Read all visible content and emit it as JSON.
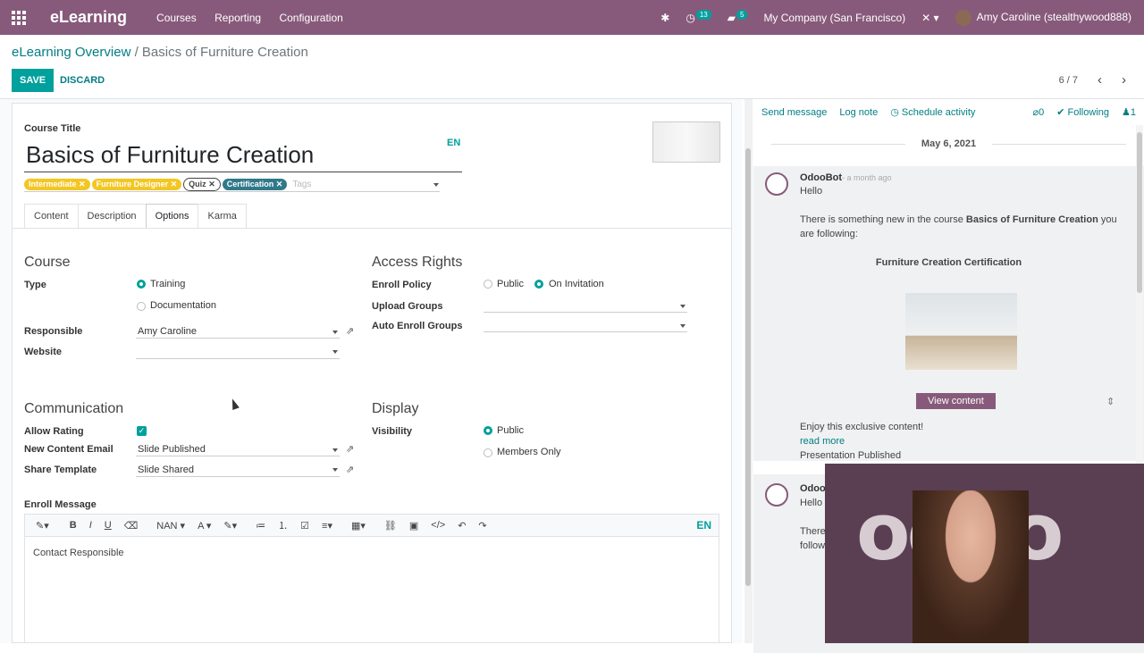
{
  "topbar": {
    "app_name": "eLearning",
    "menu": [
      "Courses",
      "Reporting",
      "Configuration"
    ],
    "activity_count": "13",
    "message_count": "5",
    "company": "My Company (San Francisco)",
    "user": "Amy Caroline (stealthywood888)"
  },
  "breadcrumb": {
    "parent": "eLearning Overview",
    "separator": "/",
    "current": "Basics of Furniture Creation"
  },
  "buttons": {
    "save": "SAVE",
    "discard": "DISCARD"
  },
  "pager": {
    "text": "6 / 7",
    "prev": "‹",
    "next": "›"
  },
  "form": {
    "course_title_label": "Course Title",
    "course_title": "Basics of Furniture Creation",
    "lang": "EN",
    "tags": [
      {
        "label": "Intermediate",
        "style": "yellow"
      },
      {
        "label": "Furniture Designer",
        "style": "yellow"
      },
      {
        "label": "Quiz",
        "style": "white"
      },
      {
        "label": "Certification",
        "style": "blue"
      }
    ],
    "tags_placeholder": "Tags",
    "tabs": [
      "Content",
      "Description",
      "Options",
      "Karma"
    ],
    "active_tab": "Options",
    "course_section": {
      "title": "Course",
      "type_label": "Type",
      "type_options": [
        "Training",
        "Documentation"
      ],
      "type_selected": "Training",
      "responsible_label": "Responsible",
      "responsible": "Amy Caroline",
      "website_label": "Website",
      "website": ""
    },
    "access_section": {
      "title": "Access Rights",
      "enroll_policy_label": "Enroll Policy",
      "enroll_options": [
        "Public",
        "On Invitation"
      ],
      "enroll_selected": "On Invitation",
      "upload_groups_label": "Upload Groups",
      "auto_enroll_label": "Auto Enroll Groups"
    },
    "communication_section": {
      "title": "Communication",
      "allow_rating_label": "Allow Rating",
      "allow_rating": true,
      "new_content_email_label": "New Content Email",
      "new_content_email": "Slide Published",
      "share_template_label": "Share Template",
      "share_template": "Slide Shared"
    },
    "display_section": {
      "title": "Display",
      "visibility_label": "Visibility",
      "visibility_options": [
        "Public",
        "Members Only"
      ],
      "visibility_selected": "Public"
    },
    "enroll_message_label": "Enroll Message",
    "editor": {
      "toolbar": [
        "✎▾",
        "B",
        "I",
        "U",
        "⌫",
        "NAN ▾",
        "A ▾",
        "✎▾",
        "≔",
        "⒈",
        "☑",
        "≡▾",
        "▦▾",
        "⛓",
        "▣",
        "</>",
        "↶",
        "↷"
      ],
      "lang": "EN",
      "content": "Contact Responsible"
    }
  },
  "chatter": {
    "send_message": "Send message",
    "log_note": "Log note",
    "schedule_activity": "Schedule activity",
    "attachments": "0",
    "following": "Following",
    "followers": "1",
    "date": "May 6, 2021",
    "message": {
      "author": "OdooBot",
      "time": "- a month ago",
      "greeting": "Hello",
      "body_pre": "There is something new in the course ",
      "body_course": "Basics of Furniture Creation",
      "body_post": " you are following:",
      "certification": "Furniture Creation Certification",
      "view_button": "View content",
      "tagline": "Enjoy this exclusive content!",
      "read_more": "read more",
      "footer": "Presentation Published"
    },
    "message2": {
      "author": "Odoo",
      "greeting": "Hello",
      "body_start": "There",
      "body_start2": "follow"
    }
  },
  "video_overlay": {
    "logo": "odoo"
  }
}
